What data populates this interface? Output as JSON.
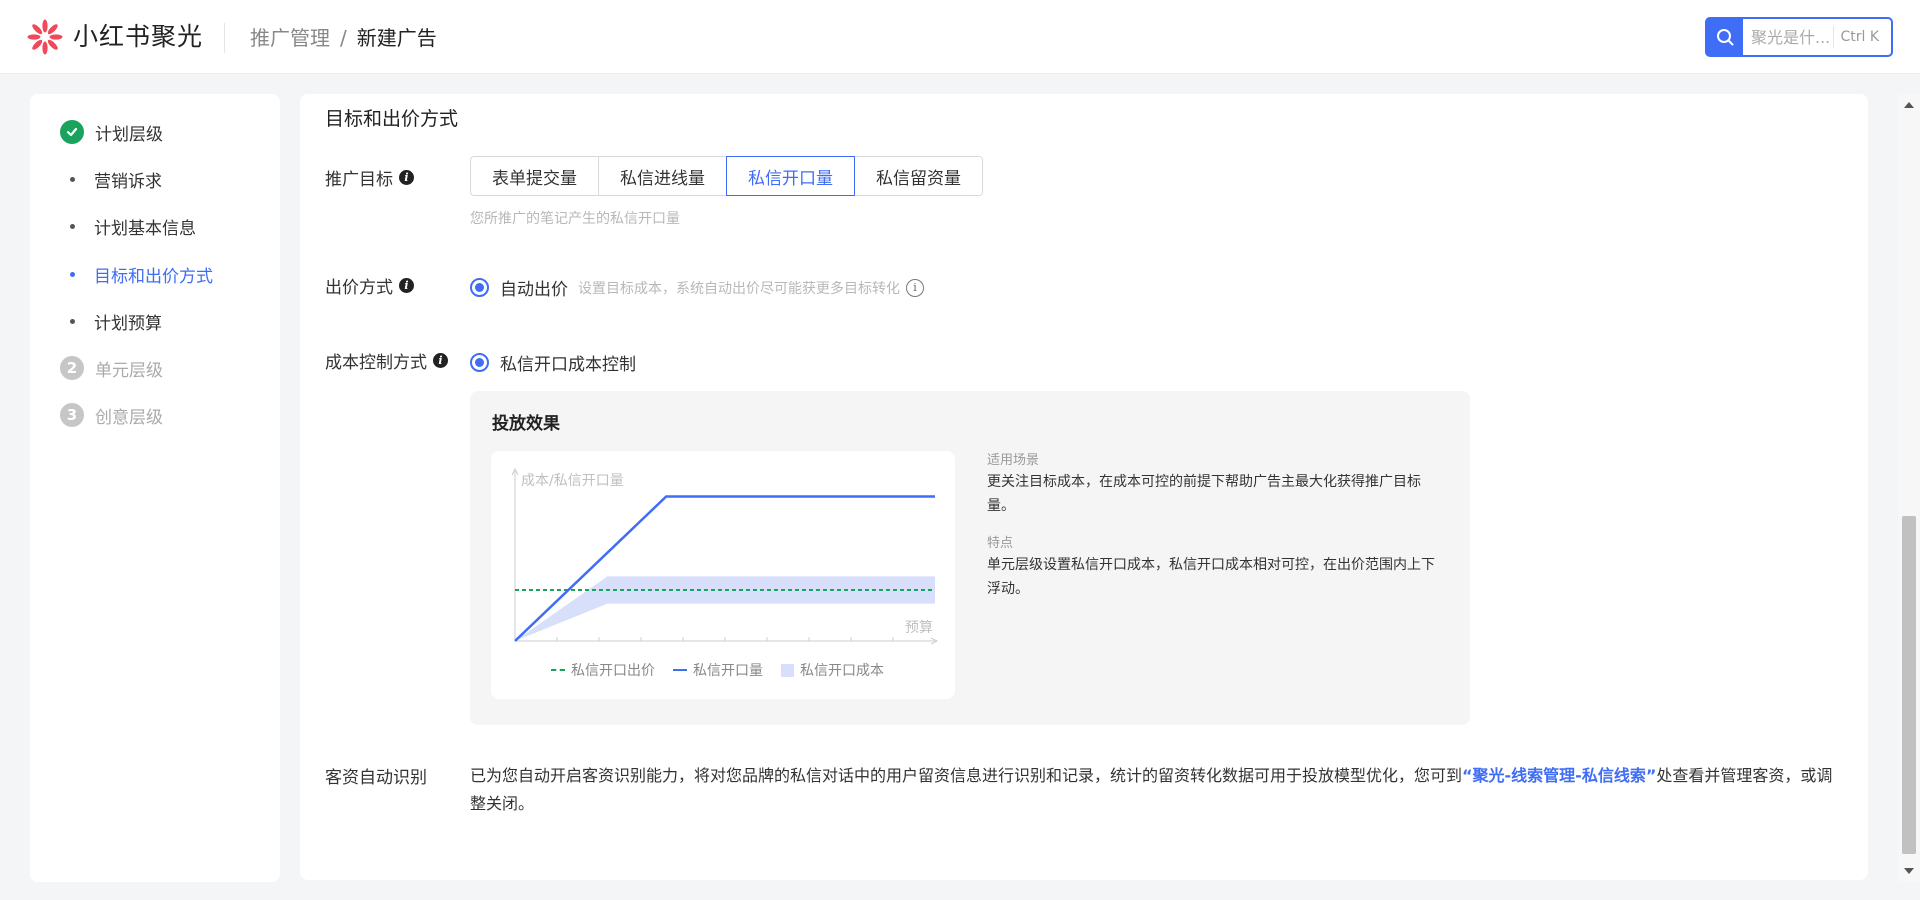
{
  "header": {
    "brand": "小红书聚光",
    "breadcrumb": {
      "parent": "推广管理",
      "separator": "/",
      "current": "新建广告"
    },
    "search": {
      "placeholder": "聚光是什...",
      "shortcut": "Ctrl K"
    },
    "logo_icon": "flower-logo-icon",
    "accent_color": "#3f6df5"
  },
  "sidenav": {
    "steps": [
      {
        "number": "1",
        "label": "计划层级",
        "status": "done"
      },
      {
        "number": "2",
        "label": "单元层级",
        "status": "todo"
      },
      {
        "number": "3",
        "label": "创意层级",
        "status": "todo"
      }
    ],
    "sub_items": [
      "营销诉求",
      "计划基本信息",
      "目标和出价方式",
      "计划预算"
    ],
    "active_sub_item": "目标和出价方式"
  },
  "main": {
    "section_title": "目标和出价方式",
    "goal": {
      "label": "推广目标",
      "options": [
        "表单提交量",
        "私信进线量",
        "私信开口量",
        "私信留资量"
      ],
      "selected": "私信开口量",
      "hint": "您所推广的笔记产生的私信开口量"
    },
    "bid": {
      "label": "出价方式",
      "option": "自动出价",
      "hint": "设置目标成本，系统自动出价尽可能获更多目标转化"
    },
    "cost_control": {
      "label": "成本控制方式",
      "option": "私信开口成本控制"
    },
    "effect": {
      "title": "投放效果",
      "scene_head": "适用场景",
      "scene_body": "更关注目标成本，在成本可控的前提下帮助广告主最大化获得推广目标量。",
      "feature_head": "特点",
      "feature_body": "单元层级设置私信开口成本，私信开口成本相对可控，在出价范围内上下浮动。"
    },
    "leads": {
      "label": "客资自动识别",
      "text_before": "已为您自动开启客资识别能力，将对您品牌的私信对话中的用户留资信息进行识别和记录，统计的留资转化数据可用于投放模型优化，您可到",
      "link": "“聚光-线索管理-私信线索”",
      "text_after": "处查看并管理客资，或调整关闭。"
    }
  },
  "chart_data": {
    "type": "line",
    "ylabel": "成本/私信开口量",
    "xlabel": "预算",
    "legend": [
      "私信开口出价",
      "私信开口量",
      "私信开口成本"
    ],
    "legend_placement": "bottom",
    "colors": {
      "bid": "#1aa35c",
      "volume": "#3f6df5",
      "cost_band": "#d7dffb"
    },
    "series": [
      {
        "name": "私信开口出价",
        "style": "dashed",
        "x": [
          0,
          10
        ],
        "y": [
          3,
          3
        ]
      },
      {
        "name": "私信开口量",
        "style": "solid",
        "x": [
          0,
          3.6,
          10
        ],
        "y": [
          0,
          8.5,
          8.5
        ]
      },
      {
        "name": "私信开口成本",
        "style": "band",
        "x": [
          0,
          2.2,
          10
        ],
        "lower": [
          0,
          2.2,
          2.2
        ],
        "upper": [
          0,
          3.8,
          3.8
        ]
      }
    ],
    "xlim": [
      0,
      10
    ],
    "ylim": [
      0,
      10
    ],
    "grid": false
  }
}
